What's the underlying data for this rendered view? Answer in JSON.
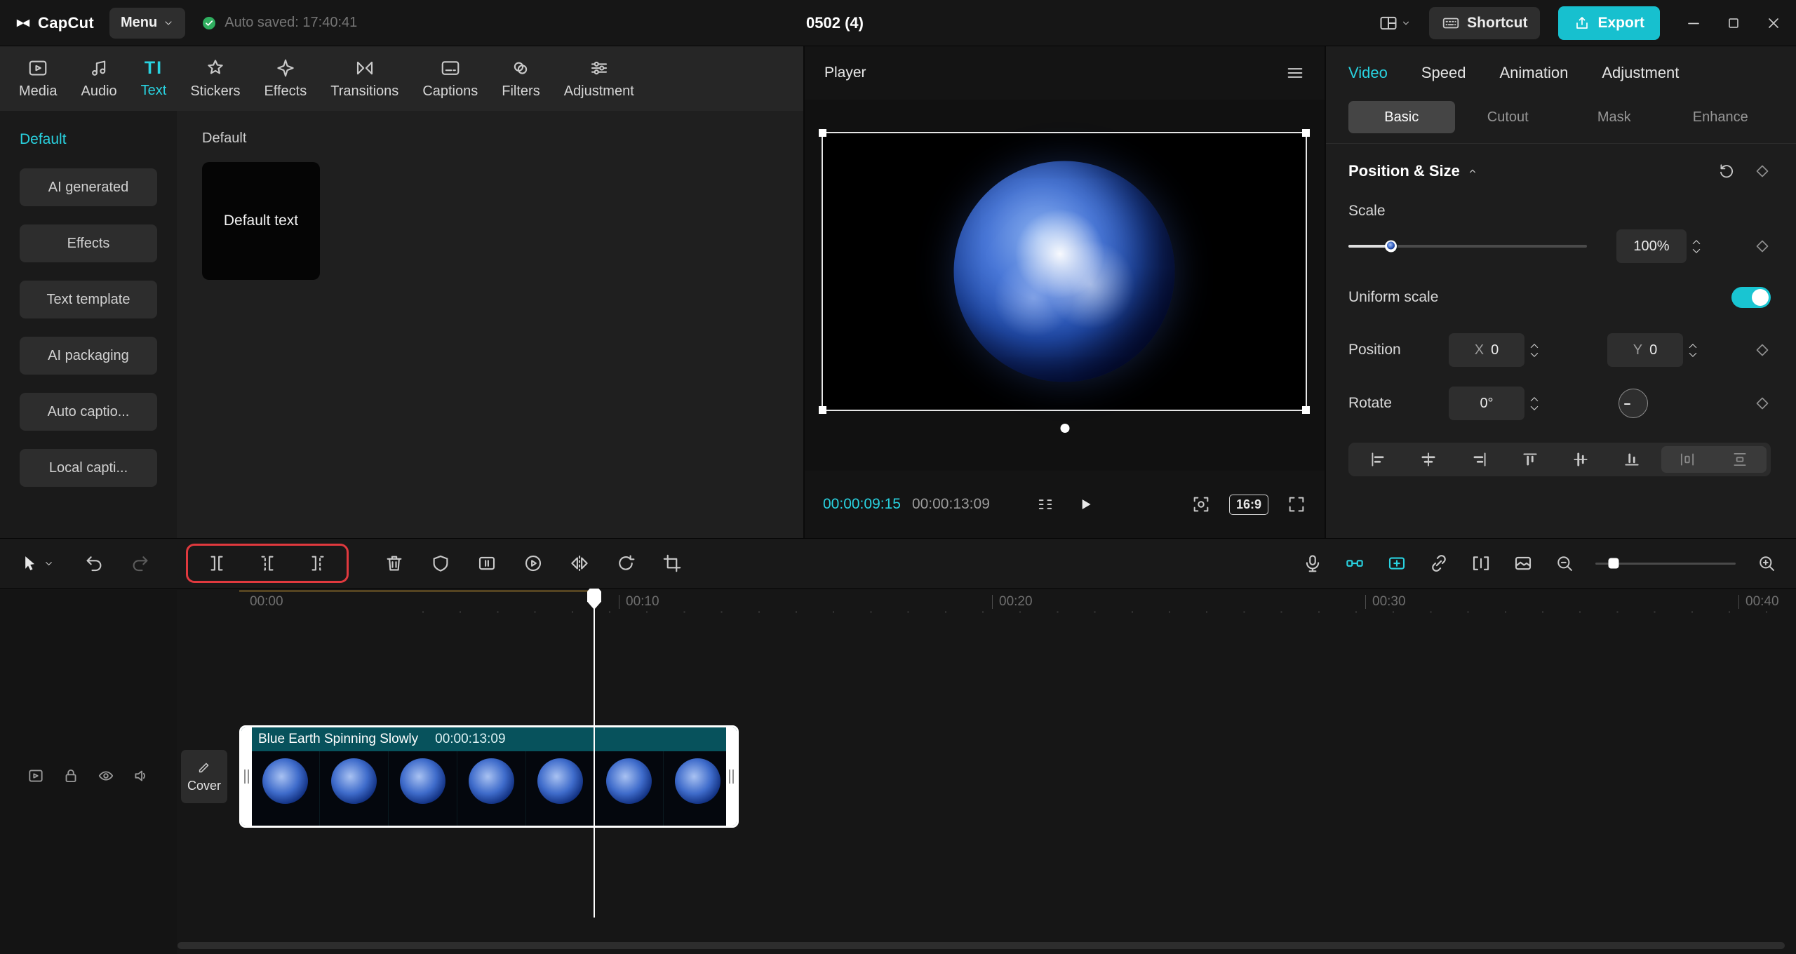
{
  "topbar": {
    "app_name": "CapCut",
    "menu_label": "Menu",
    "autosave_text": "Auto saved: 17:40:41",
    "project_title": "0502 (4)",
    "shortcut_label": "Shortcut",
    "export_label": "Export"
  },
  "media": {
    "text_tab_icon": "TI",
    "tabs": [
      {
        "label": "Media",
        "active": false
      },
      {
        "label": "Audio",
        "active": false
      },
      {
        "label": "Text",
        "active": true
      },
      {
        "label": "Stickers",
        "active": false
      },
      {
        "label": "Effects",
        "active": false
      },
      {
        "label": "Transitions",
        "active": false
      },
      {
        "label": "Captions",
        "active": false
      },
      {
        "label": "Filters",
        "active": false
      },
      {
        "label": "Adjustment",
        "active": false
      }
    ],
    "categories": [
      {
        "label": "Default",
        "active": true
      },
      {
        "label": "AI generated",
        "active": false
      },
      {
        "label": "Effects",
        "active": false
      },
      {
        "label": "Text template",
        "active": false
      },
      {
        "label": "AI packaging",
        "active": false
      },
      {
        "label": "Auto captio...",
        "active": false
      },
      {
        "label": "Local capti...",
        "active": false
      }
    ],
    "section_title": "Default",
    "default_text_card": "Default text"
  },
  "player": {
    "title": "Player",
    "current_time": "00:00:09:15",
    "duration": "00:00:13:09",
    "aspect_ratio": "16:9"
  },
  "properties": {
    "tabs": [
      {
        "label": "Video",
        "active": true
      },
      {
        "label": "Speed",
        "active": false
      },
      {
        "label": "Animation",
        "active": false
      },
      {
        "label": "Adjustment",
        "active": false
      }
    ],
    "subtabs": [
      {
        "label": "Basic",
        "active": true
      },
      {
        "label": "Cutout",
        "active": false
      },
      {
        "label": "Mask",
        "active": false
      },
      {
        "label": "Enhance",
        "active": false
      }
    ],
    "position_size": {
      "title": "Position & Size",
      "scale_label": "Scale",
      "scale_value": "100%",
      "uniform_scale_label": "Uniform scale",
      "uniform_scale_on": true,
      "position_label": "Position",
      "x_label": "X",
      "x_value": "0",
      "y_label": "Y",
      "y_value": "0",
      "rotate_label": "Rotate",
      "rotate_value": "0°"
    }
  },
  "timeline": {
    "cover_label": "Cover",
    "ruler_labels": [
      "00:00",
      "00:10",
      "00:20",
      "00:30",
      "00:40"
    ],
    "clip": {
      "title": "Blue Earth Spinning Slowly",
      "duration": "00:00:13:09"
    }
  },
  "colors": {
    "accent": "#29d2e0",
    "export_button": "#17c0cf",
    "highlight_red": "#e0393e",
    "autosave_green": "#2fae5f",
    "clip_teal": "#07525c"
  }
}
